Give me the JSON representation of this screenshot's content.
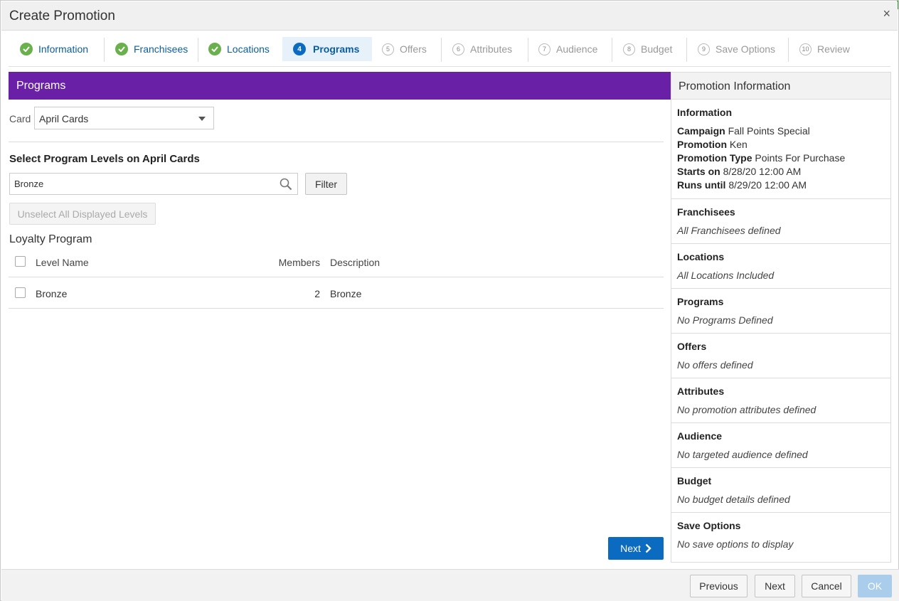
{
  "dialog": {
    "title": "Create Promotion",
    "close_glyph": "×"
  },
  "steps": [
    {
      "num": "",
      "label": "Information",
      "state": "done"
    },
    {
      "num": "",
      "label": "Franchisees",
      "state": "done"
    },
    {
      "num": "",
      "label": "Locations",
      "state": "done"
    },
    {
      "num": "4",
      "label": "Programs",
      "state": "active"
    },
    {
      "num": "5",
      "label": "Offers",
      "state": "todo"
    },
    {
      "num": "6",
      "label": "Attributes",
      "state": "todo"
    },
    {
      "num": "7",
      "label": "Audience",
      "state": "todo"
    },
    {
      "num": "8",
      "label": "Budget",
      "state": "todo"
    },
    {
      "num": "9",
      "label": "Save Options",
      "state": "todo"
    },
    {
      "num": "10",
      "label": "Review",
      "state": "todo"
    }
  ],
  "programs": {
    "header": "Programs",
    "card_label": "Card",
    "card_value": "April Cards",
    "section_title": "Select Program Levels on April Cards",
    "search_value": "Bronze",
    "filter_label": "Filter",
    "unselect_label": "Unselect All Displayed Levels",
    "program_name": "Loyalty Program",
    "columns": {
      "name": "Level Name",
      "members": "Members",
      "description": "Description"
    },
    "rows": [
      {
        "name": "Bronze",
        "members": "2",
        "description": "Bronze"
      }
    ],
    "next_label": "Next"
  },
  "info": {
    "header": "Promotion Information",
    "information": {
      "title": "Information",
      "campaign_key": "Campaign",
      "campaign_val": "Fall Points Special",
      "promotion_key": "Promotion",
      "promotion_val": "Ken",
      "type_key": "Promotion Type",
      "type_val": "Points For Purchase",
      "starts_key": "Starts on",
      "starts_val": "8/28/20 12:00 AM",
      "runs_key": "Runs until",
      "runs_val": "8/29/20 12:00 AM"
    },
    "sections": [
      {
        "title": "Franchisees",
        "text": "All Franchisees defined"
      },
      {
        "title": "Locations",
        "text": "All Locations Included"
      },
      {
        "title": "Programs",
        "text": "No Programs Defined"
      },
      {
        "title": "Offers",
        "text": "No offers defined"
      },
      {
        "title": "Attributes",
        "text": "No promotion attributes defined"
      },
      {
        "title": "Audience",
        "text": "No targeted audience defined"
      },
      {
        "title": "Budget",
        "text": "No budget details defined"
      },
      {
        "title": "Save Options",
        "text": "No save options to display"
      }
    ]
  },
  "footer": {
    "previous": "Previous",
    "next": "Next",
    "cancel": "Cancel",
    "ok": "OK"
  },
  "colors": {
    "header_purple": "#6a1fa7",
    "primary_blue": "#0a6bc0",
    "check_green": "#6ab04c"
  }
}
